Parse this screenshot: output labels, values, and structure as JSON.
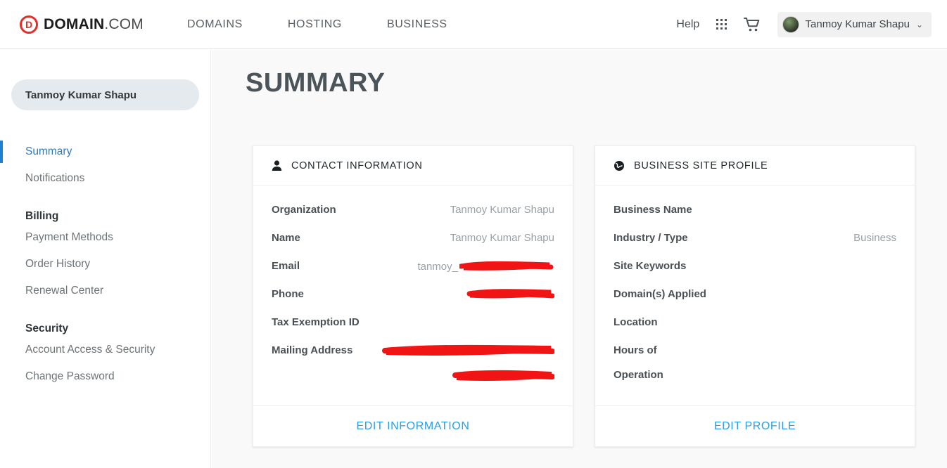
{
  "header": {
    "logo": {
      "mark": "D",
      "bold": "DOMAIN",
      "light": ".COM"
    },
    "nav": [
      {
        "label": "DOMAINS"
      },
      {
        "label": "HOSTING"
      },
      {
        "label": "BUSINESS"
      }
    ],
    "help_label": "Help",
    "apps_icon": "grid-apps-icon",
    "cart_icon": "shopping-cart-icon",
    "user": {
      "name": "Tanmoy Kumar Shapu",
      "caret": "⌄"
    }
  },
  "sidebar": {
    "account_name": "Tanmoy Kumar Shapu",
    "items": [
      {
        "label": "Summary",
        "active": true
      },
      {
        "label": "Notifications",
        "active": false
      }
    ],
    "groups": [
      {
        "title": "Billing",
        "items": [
          {
            "label": "Payment Methods"
          },
          {
            "label": "Order History"
          },
          {
            "label": "Renewal Center"
          }
        ]
      },
      {
        "title": "Security",
        "items": [
          {
            "label": "Account Access & Security"
          },
          {
            "label": "Change Password"
          }
        ]
      }
    ]
  },
  "main": {
    "page_title": "SUMMARY",
    "cards": [
      {
        "icon": "person-icon",
        "title": "CONTACT INFORMATION",
        "rows": [
          {
            "label": "Organization",
            "value": "Tanmoy Kumar Shapu",
            "redacted": false
          },
          {
            "label": "Name",
            "value": "Tanmoy Kumar Shapu",
            "redacted": false
          },
          {
            "label": "Email",
            "value": "tanmoy_",
            "redacted": true
          },
          {
            "label": "Phone",
            "value": "",
            "redacted": true
          },
          {
            "label": "Tax Exemption ID",
            "value": "",
            "redacted": false
          },
          {
            "label": "Mailing Address",
            "value": "",
            "redacted": true
          }
        ],
        "action": "EDIT INFORMATION"
      },
      {
        "icon": "globe-icon",
        "title": "BUSINESS SITE PROFILE",
        "rows": [
          {
            "label": "Business Name",
            "value": "",
            "redacted": false
          },
          {
            "label": "Industry / Type",
            "value": "Business",
            "redacted": false
          },
          {
            "label": "Site Keywords",
            "value": "",
            "redacted": false
          },
          {
            "label": "Domain(s) Applied",
            "value": "",
            "redacted": false
          },
          {
            "label": "Location",
            "value": "",
            "redacted": false
          },
          {
            "label": "Hours of",
            "value": "",
            "redacted": false
          },
          {
            "label": "Operation",
            "value": "",
            "redacted": false
          }
        ],
        "action": "EDIT PROFILE"
      }
    ]
  },
  "colors": {
    "brand_red": "#e03028",
    "accent_blue": "#2b9fe0",
    "active_blue": "#2b7cc4",
    "redaction_red": "#f11414"
  }
}
